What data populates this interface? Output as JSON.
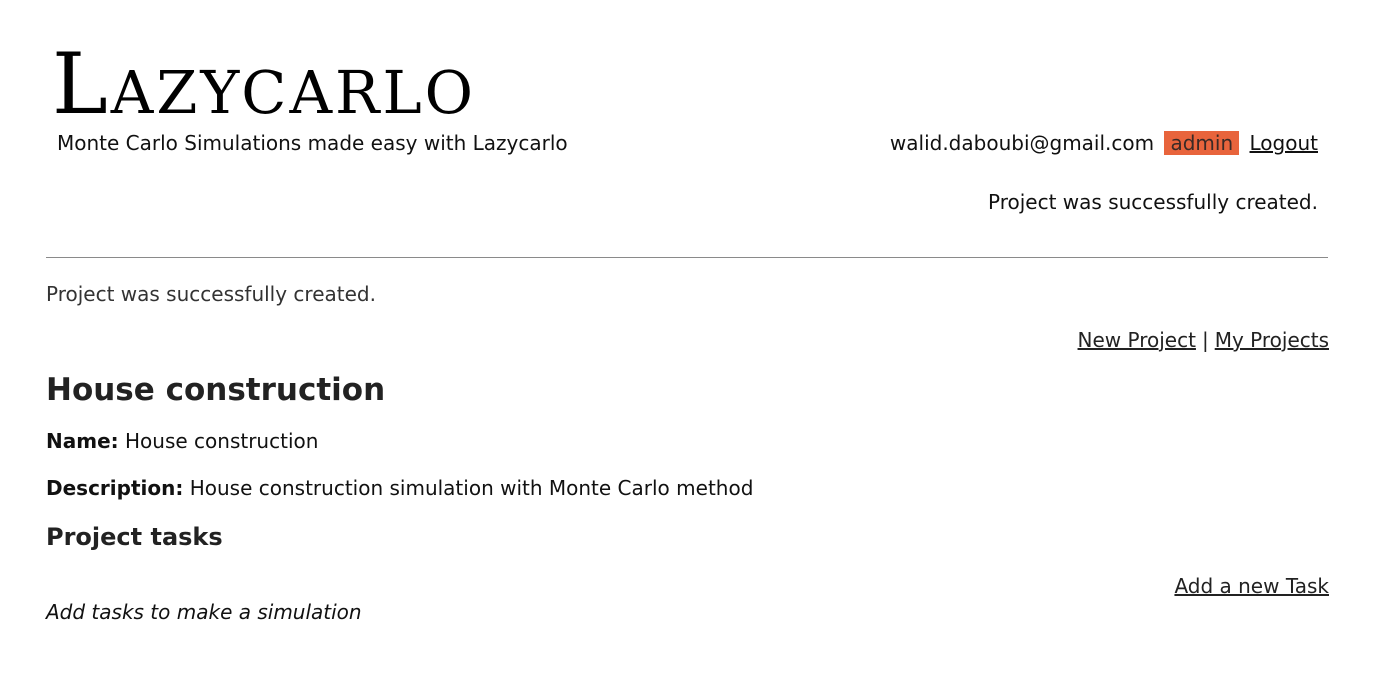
{
  "header": {
    "brand": "Lazycarlo",
    "tagline": "Monte Carlo Simulations made easy with Lazycarlo"
  },
  "user_bar": {
    "email": "walid.daboubi@gmail.com",
    "role_badge": "admin",
    "logout_label": "Logout"
  },
  "flash_top": "Project was successfully created.",
  "notice": "Project was successfully created.",
  "nav": {
    "new_project_label": "New Project",
    "separator": "|",
    "my_projects_label": "My Projects"
  },
  "project": {
    "title": "House construction",
    "name_label": "Name:",
    "name_value": "House construction",
    "description_label": "Description:",
    "description_value": "House construction simulation with Monte Carlo method"
  },
  "tasks": {
    "heading": "Project tasks",
    "add_label": "Add a new Task",
    "empty_message": "Add tasks to make a simulation"
  },
  "colors": {
    "admin_badge": "#e8643c",
    "divider": "#8a8a8a"
  }
}
